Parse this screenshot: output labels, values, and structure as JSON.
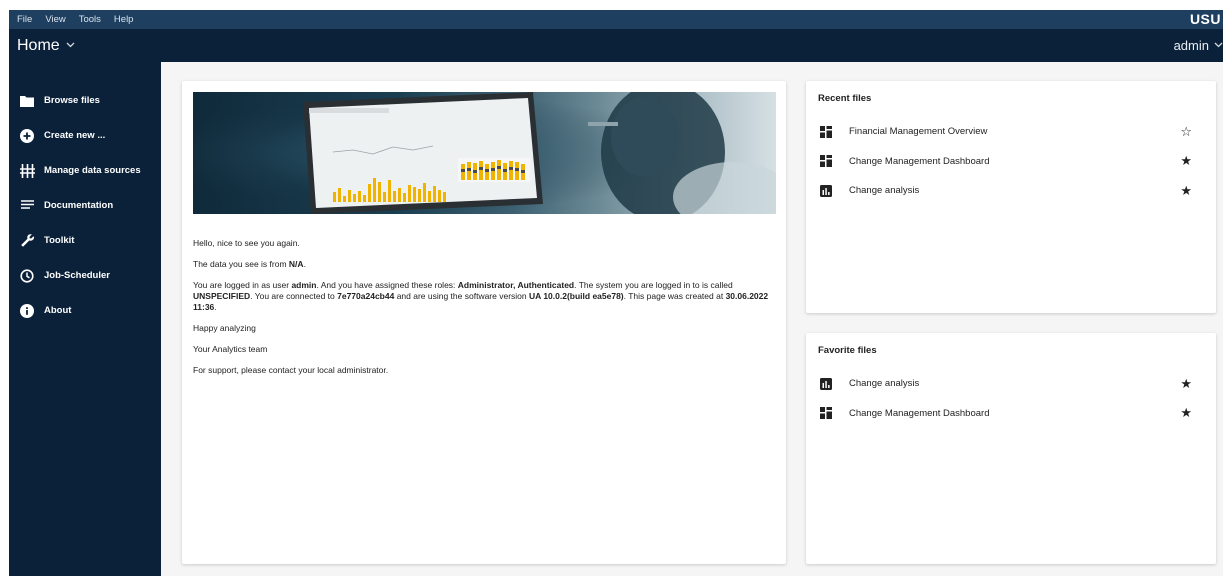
{
  "menubar": {
    "items": [
      "File",
      "View",
      "Tools",
      "Help"
    ],
    "brand": "USU"
  },
  "header": {
    "title": "Home",
    "user": "admin"
  },
  "sidebar": {
    "items": [
      {
        "label": "Browse files",
        "icon": "folder-icon"
      },
      {
        "label": "Create new ...",
        "icon": "add-circle-icon"
      },
      {
        "label": "Manage data sources",
        "icon": "data-sources-icon"
      },
      {
        "label": "Documentation",
        "icon": "documentation-icon"
      },
      {
        "label": "Toolkit",
        "icon": "wrench-icon"
      },
      {
        "label": "Job-Scheduler",
        "icon": "clock-icon"
      },
      {
        "label": "About",
        "icon": "info-icon"
      }
    ]
  },
  "welcome": {
    "greeting": "Hello, nice to see you again.",
    "data_from_prefix": "The data you see is from ",
    "data_from_value": "N/A",
    "data_from_suffix": ".",
    "login_1": "You are logged in as user ",
    "user": "admin",
    "login_2": ". And you have assigned these roles: ",
    "roles": "Administrator, Authenticated",
    "login_3": ". The system you are logged in to is called ",
    "system": "UNSPECIFIED",
    "login_4": ". You are connected to ",
    "host": "7e770a24cb44",
    "login_5": " and are using the software version ",
    "version": "UA 10.0.2(build ea5e78)",
    "login_6": ". This page was created at ",
    "created": "30.06.2022 11:36",
    "login_7": ".",
    "happy": "Happy analyzing",
    "team": "Your Analytics team",
    "support": "For support, please contact your local administrator."
  },
  "recent_files": {
    "title": "Recent files",
    "items": [
      {
        "name": "Financial Management Overview",
        "icon": "dashboard-icon",
        "starred": false
      },
      {
        "name": "Change Management Dashboard",
        "icon": "dashboard-icon",
        "starred": true
      },
      {
        "name": "Change analysis",
        "icon": "analysis-icon",
        "starred": true
      }
    ]
  },
  "favorite_files": {
    "title": "Favorite files",
    "items": [
      {
        "name": "Change analysis",
        "icon": "analysis-icon",
        "starred": true
      },
      {
        "name": "Change Management Dashboard",
        "icon": "dashboard-icon",
        "starred": true
      }
    ]
  },
  "colors": {
    "menubar": "#1e3f5f",
    "header": "#0b2139",
    "sidebar": "#0b2139",
    "accent_chart": "#f0b400"
  }
}
